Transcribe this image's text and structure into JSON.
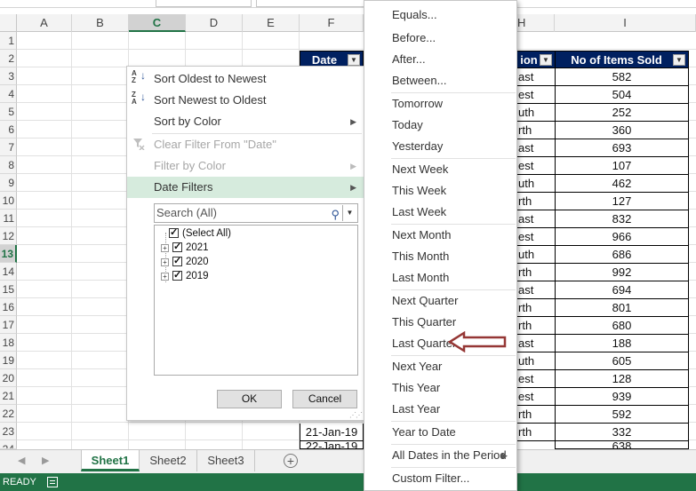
{
  "columns": [
    "A",
    "B",
    "C",
    "D",
    "E",
    "F",
    "H",
    "I"
  ],
  "rows": [
    "1",
    "2",
    "3",
    "4",
    "5",
    "6",
    "7",
    "8",
    "9",
    "10",
    "11",
    "12",
    "13",
    "14",
    "15",
    "16",
    "17",
    "18",
    "19",
    "20",
    "21",
    "22",
    "23",
    "24"
  ],
  "table": {
    "headers": {
      "date": "Date",
      "region": "ion",
      "items": "No of Items Sold"
    },
    "region_cells": [
      "ast",
      "est",
      "uth",
      "rth",
      "ast",
      "est",
      "uth",
      "rth",
      "ast",
      "est",
      "uth",
      "rth",
      "ast",
      "rth",
      "rth",
      "ast",
      "uth",
      "est",
      "est",
      "rth",
      "rth"
    ],
    "items_cells": [
      "582",
      "504",
      "252",
      "360",
      "693",
      "107",
      "462",
      "127",
      "832",
      "966",
      "686",
      "992",
      "694",
      "801",
      "680",
      "188",
      "605",
      "128",
      "939",
      "592",
      "332"
    ],
    "date_cells": [
      "21-Jan-19",
      "22-Jan-19"
    ],
    "partial_row_24": "638"
  },
  "filter_menu": {
    "sort_oldest": "Sort Oldest to Newest",
    "sort_newest": "Sort Newest to Oldest",
    "sort_color": "Sort by Color",
    "clear_filter": "Clear Filter From \"Date\"",
    "filter_color": "Filter by Color",
    "date_filters": "Date Filters",
    "search_placeholder": "Search (All)",
    "tree": {
      "select_all": "(Select All)",
      "years": [
        "2021",
        "2020",
        "2019"
      ]
    },
    "ok": "OK",
    "cancel": "Cancel"
  },
  "date_submenu": {
    "equals": "Equals...",
    "before": "Before...",
    "after": "After...",
    "between": "Between...",
    "tomorrow": "Tomorrow",
    "today": "Today",
    "yesterday": "Yesterday",
    "next_week": "Next Week",
    "this_week": "This Week",
    "last_week": "Last Week",
    "next_month": "Next Month",
    "this_month": "This Month",
    "last_month": "Last Month",
    "next_quarter": "Next Quarter",
    "this_quarter": "This Quarter",
    "last_quarter": "Last Quarter",
    "next_year": "Next Year",
    "this_year": "This Year",
    "last_year": "Last Year",
    "year_to_date": "Year to Date",
    "all_dates": "All Dates in the Period",
    "custom": "Custom Filter..."
  },
  "sheets": [
    "Sheet1",
    "Sheet2",
    "Sheet3"
  ],
  "status": "READY",
  "colors": {
    "header_fill": "#002060",
    "excel_green": "#217346",
    "highlight": "#d6ebdd",
    "callout_arrow": "#953735"
  }
}
